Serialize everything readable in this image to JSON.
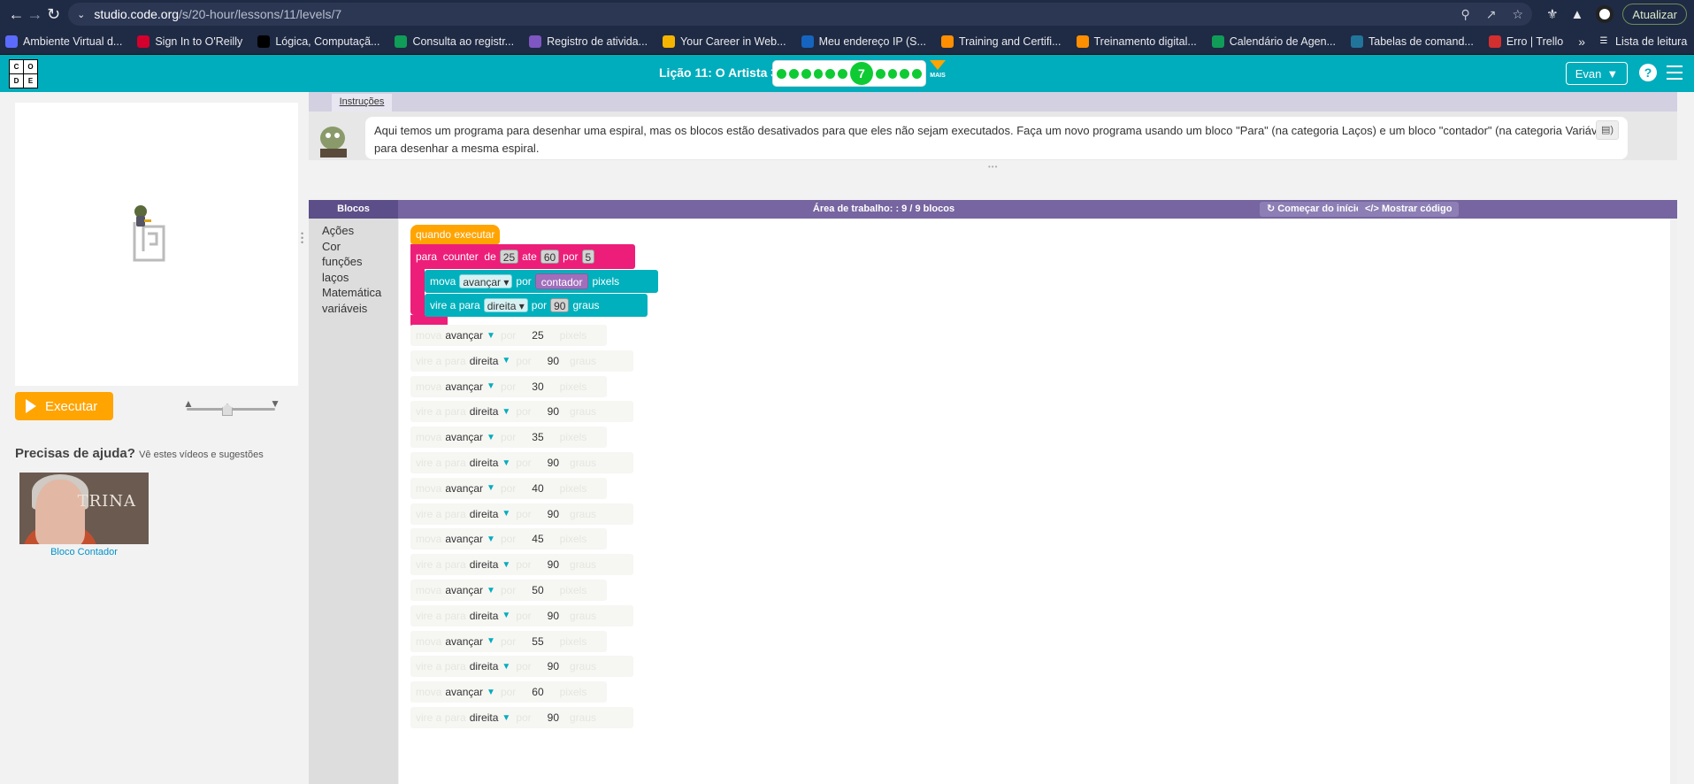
{
  "browser": {
    "url_domain": "studio.code.org",
    "url_path": "/s/20-hour/lessons/11/levels/7",
    "update_label": "Atualizar",
    "bookmarks": [
      {
        "label": "Ambiente Virtual d...",
        "color": "#5b6bff"
      },
      {
        "label": "Sign In to O'Reilly",
        "color": "#d3002d"
      },
      {
        "label": "Lógica, Computaçã...",
        "color": "#000000"
      },
      {
        "label": "Consulta ao registr...",
        "color": "#0f9d58"
      },
      {
        "label": "Registro de ativida...",
        "color": "#7e57c2"
      },
      {
        "label": "Your Career in Web...",
        "color": "#f4b400"
      },
      {
        "label": "Meu endereço IP (S...",
        "color": "#1565c0"
      },
      {
        "label": "Training and Certifi...",
        "color": "#ff8f00"
      },
      {
        "label": "Treinamento digital...",
        "color": "#ff8f00"
      },
      {
        "label": "Calendário de Agen...",
        "color": "#0f9d58"
      },
      {
        "label": "Tabelas de comand...",
        "color": "#21759b"
      },
      {
        "label": "Erro | Trello",
        "color": "#d32f2f"
      }
    ],
    "reading_list": "Lista de leitura"
  },
  "header": {
    "logo_letters": [
      "C",
      "O",
      "D",
      "E"
    ],
    "lesson_title": "Lição 11: O Artista 3",
    "current_level": "7",
    "more_label": "MAIS",
    "user_name": "Evan",
    "help_glyph": "?"
  },
  "left": {
    "run_label": "Executar",
    "help_title": "Precisas de ajuda?",
    "help_subtitle": "Vê estes vídeos e sugestões",
    "video_overlay": "TRINA",
    "video_label": "Bloco Contador"
  },
  "instructions": {
    "tab_label": "Instruções",
    "text": "Aqui temos um programa para desenhar uma espiral, mas os blocos estão desativados para que eles não sejam executados. Faça um novo programa usando um bloco \"Para\" (na categoria Laços) e um bloco \"contador\" (na categoria Variáveis) para desenhar a mesma espiral."
  },
  "workspace": {
    "blocks_tab": "Blocos",
    "title": "Área de trabalho: : 9 / 9 blocos",
    "restart_label": "Começar do início",
    "show_code_label": "Mostrar código",
    "toolbox": [
      "Ações",
      "Cor",
      "funções",
      "laços",
      "Matemática",
      "variáveis"
    ],
    "program": {
      "when_run": "quando executar",
      "for_prefix": "para",
      "for_var": "counter",
      "for_from_kw": "de",
      "for_from": "25",
      "for_to_kw": "ate",
      "for_to": "60",
      "for_by_kw": "por",
      "for_by": "5",
      "move_kw": "mova",
      "move_dir": "avançar",
      "by_kw": "por",
      "counter_var": "contador",
      "pixels_kw": "pixels",
      "turn_kw": "vire a",
      "to_kw": "para",
      "turn_dir": "direita",
      "turn_by": "por",
      "turn_value": "90",
      "degrees_kw": "graus"
    },
    "disabled_blocks": [
      {
        "kind": "move",
        "dir": "avançar",
        "value": "25"
      },
      {
        "kind": "turn",
        "dir": "direita",
        "value": "90"
      },
      {
        "kind": "move",
        "dir": "avançar",
        "value": "30"
      },
      {
        "kind": "turn",
        "dir": "direita",
        "value": "90"
      },
      {
        "kind": "move",
        "dir": "avançar",
        "value": "35"
      },
      {
        "kind": "turn",
        "dir": "direita",
        "value": "90"
      },
      {
        "kind": "move",
        "dir": "avançar",
        "value": "40"
      },
      {
        "kind": "turn",
        "dir": "direita",
        "value": "90"
      },
      {
        "kind": "move",
        "dir": "avançar",
        "value": "45"
      },
      {
        "kind": "turn",
        "dir": "direita",
        "value": "90"
      },
      {
        "kind": "move",
        "dir": "avançar",
        "value": "50"
      },
      {
        "kind": "turn",
        "dir": "direita",
        "value": "90"
      },
      {
        "kind": "move",
        "dir": "avançar",
        "value": "55"
      },
      {
        "kind": "turn",
        "dir": "direita",
        "value": "90"
      },
      {
        "kind": "move",
        "dir": "avançar",
        "value": "60"
      },
      {
        "kind": "turn",
        "dir": "direita",
        "value": "90"
      }
    ],
    "disabled_words": {
      "move": "mova",
      "turn": "vire a",
      "to": "para",
      "by": "por",
      "pixels": "pixels",
      "degrees": "graus"
    }
  },
  "colors": {
    "brand": "#00adbc",
    "run": "#ffa400",
    "loop": "#ed1e79",
    "action": "#00b0bd",
    "variable": "#a16ebc",
    "progress": "#0ecb34"
  }
}
